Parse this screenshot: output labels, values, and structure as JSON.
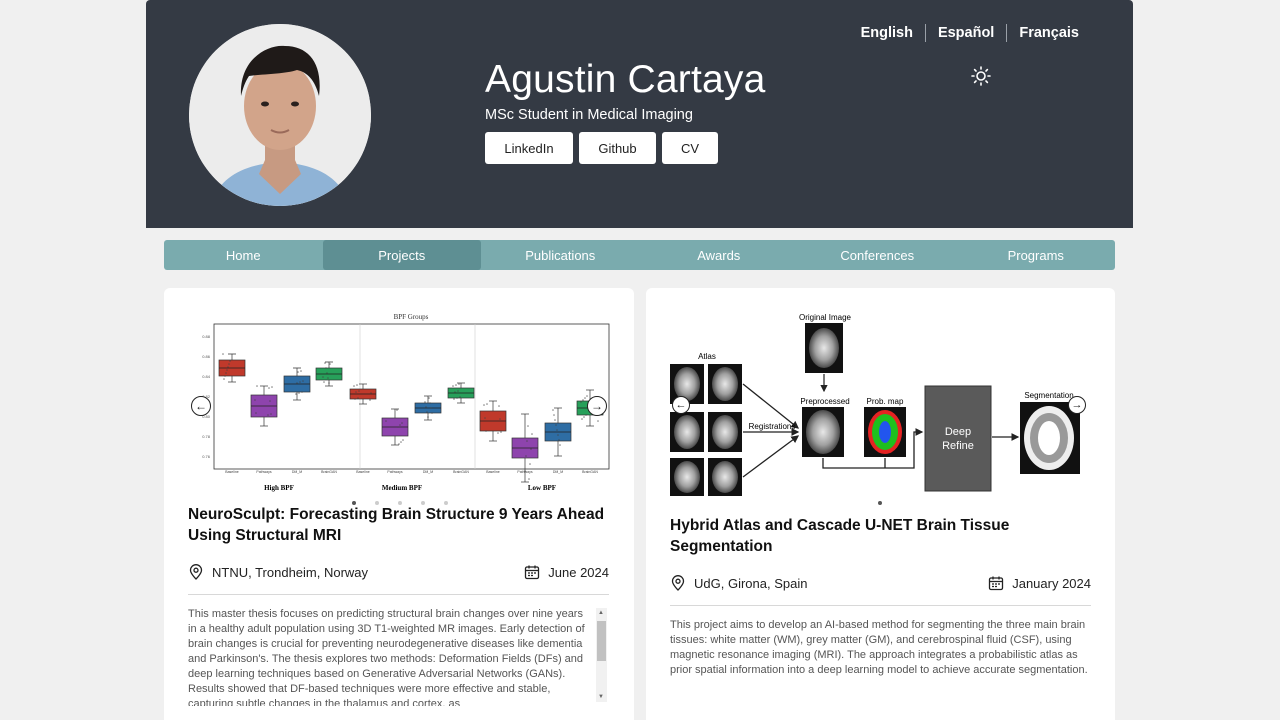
{
  "header": {
    "name": "Agustin Cartaya",
    "subtitle": "MSc Student in Medical Imaging",
    "buttons": [
      "LinkedIn",
      "Github",
      "CV"
    ],
    "languages": [
      "English",
      "Español",
      "Français"
    ],
    "theme_icon": "sun-icon"
  },
  "nav": {
    "tabs": [
      "Home",
      "Projects",
      "Publications",
      "Awards",
      "Conferences",
      "Programs"
    ],
    "active": "Projects"
  },
  "projects": [
    {
      "title": "NeuroSculpt: Forecasting Brain Structure 9 Years Ahead Using Structural MRI",
      "location": "NTNU, Trondheim, Norway",
      "date": "June 2024",
      "description": "This master thesis focuses on predicting structural brain changes over nine years in a healthy adult population using 3D T1-weighted MR images. Early detection of brain changes is crucial for preventing neurodegenerative diseases like dementia and Parkinson's. The thesis explores two methods: Deformation Fields (DFs) and deep learning techniques based on Generative Adversarial Networks (GANs). Results showed that DF-based techniques were more effective and stable, capturing subtle changes in the thalamus and cortex, as",
      "slides": 5,
      "figure": {
        "title": "BPF Groups",
        "groups": [
          "High BPF",
          "Medium BPF",
          "Low BPF"
        ],
        "tick_labels": [
          "Baseline",
          "Pathways",
          "DM_M",
          "BrainGAN",
          "Baseline",
          "Pathways",
          "DM_M",
          "BrainGAN",
          "Baseline",
          "Pathways",
          "DM_M",
          "BrainGAN"
        ],
        "ytick_labels": [
          "0.88",
          "0.86",
          "0.84",
          "0.82",
          "0.80",
          "0.78",
          "0.76"
        ],
        "colors": [
          "#c0392b",
          "#8e44ad",
          "#2e6da4",
          "#27a05a"
        ]
      }
    },
    {
      "title": "Hybrid Atlas and Cascade U-NET Brain Tissue Segmentation",
      "location": "UdG, Girona, Spain",
      "date": "January 2024",
      "description": "This project aims to develop an AI-based method for segmenting the three main brain tissues: white matter (WM), grey matter (GM), and cerebrospinal fluid (CSF), using magnetic resonance imaging (MRI). The approach integrates a probabilistic atlas as prior spatial information into a deep learning model to achieve accurate segmentation.",
      "slides": 1,
      "figure": {
        "original_label": "Original Image",
        "atlas_label": "Atlas",
        "preprocessed_label": "Preprocessed",
        "prob_label": "Prob. map",
        "registrations_label": "Registrations",
        "box_label_1": "Deep",
        "box_label_2": "Refine",
        "segmentation_label": "Segmentation"
      }
    }
  ]
}
